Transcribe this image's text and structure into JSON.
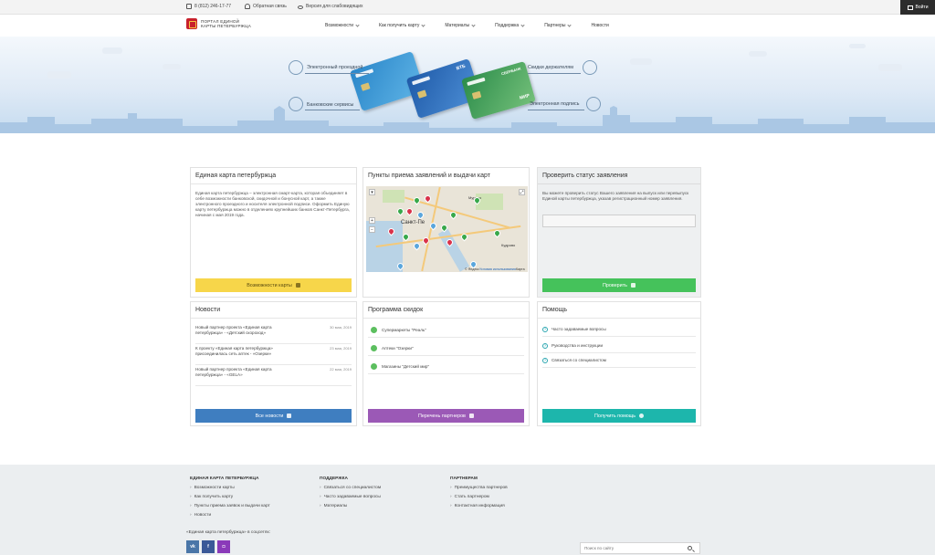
{
  "topbar": {
    "phone": "8 (812) 246-17-77",
    "feedback": "Обратная связь",
    "accessible": "Версия для слабовидящих",
    "login": "Войти"
  },
  "header": {
    "logo_line1": "ПОРТАЛ ЕДИНОЙ",
    "logo_line2": "КАРТЫ ПЕТЕРБУРЖЦА",
    "nav": [
      {
        "label": "Возможности",
        "has_menu": true
      },
      {
        "label": "Как получить карту",
        "has_menu": true
      },
      {
        "label": "Материалы",
        "has_menu": true
      },
      {
        "label": "Поддержка",
        "has_menu": true
      },
      {
        "label": "Партнеры",
        "has_menu": true
      },
      {
        "label": "Новости",
        "has_menu": false
      }
    ]
  },
  "banner": {
    "label_transport": "Электронный проездной",
    "label_discounts": "Скидки держателям",
    "label_bank": "Банковские сервисы",
    "label_signature": "Электронная подпись",
    "card2_brand": "ВТБ",
    "card3_brand": "СБЕРБАНК",
    "card3_mir": "МИР"
  },
  "card_panel": {
    "title": "Единая карта петербуржца",
    "text": "Единая карта петербуржца – электронная смарт-карта, которая объединяет в себе возможности банковской, скидочной и бонусной карт, а также электронного проездного и носителя электронной подписи. Оформить Единую карту петербуржца можно в отделениях крупнейших банков Санкт-Петербурга, начиная с мая 2019 года.",
    "button": "Возможности карты"
  },
  "map_panel": {
    "title": "Пункты приема заявлений и выдачи карт",
    "city_label": "Санкт-Пе",
    "district_label": "Кудрово",
    "district2_label": "Мурино",
    "footer_left": "© Яндекс",
    "footer_terms": "Условия использования",
    "footer_right": "Карта"
  },
  "status_panel": {
    "title": "Проверить статус заявления",
    "text": "Вы можете проверить статус Вашего заявления на выпуск или перевыпуск Единой карты петербуржца, указав регистрационный номер заявления.",
    "input_value": "",
    "button": "Проверить"
  },
  "news_panel": {
    "title": "Новости",
    "items": [
      {
        "text": "Новый партнер проекта «Единая карта петербуржца» - «Детский скороход»",
        "date": "30 мая, 2019"
      },
      {
        "text": "К проекту «Единая карта петербуржца» присоединилась сеть аптек - «Озерки»",
        "date": "23 мая, 2019"
      },
      {
        "text": "Новый партнер проекта «Единая карта петербуржца» - «GELA»",
        "date": "22 мая, 2019"
      }
    ],
    "button": "Все новости"
  },
  "discount_panel": {
    "title": "Программа скидок",
    "items": [
      "Супермаркеты \"Реаль\"",
      "Аптеки \"Озерки\"",
      "Магазины \"Детский мир\""
    ],
    "button": "Перечень партнеров"
  },
  "help_panel": {
    "title": "Помощь",
    "items": [
      "Часто задаваемые вопросы",
      "Руководства и инструкции",
      "Связаться со специалистом"
    ],
    "button": "Получить помощь"
  },
  "footer": {
    "col1_title": "ЕДИНАЯ КАРТА ПЕТЕРБУРЖЦА",
    "col1_links": [
      "Возможности карты",
      "Как получить карту",
      "Пункты приема заявок и выдачи карт",
      "Новости"
    ],
    "col2_title": "ПОДДЕРЖКА",
    "col2_links": [
      "Связаться со специалистом",
      "Часто задаваемые вопросы",
      "Материалы"
    ],
    "col3_title": "ПАРТНЕРАМ",
    "col3_links": [
      "Преимущества партнеров",
      "Стать партнером",
      "Контактная информация"
    ],
    "social_caption": "«Единая карта петербуржца» в соцсетях:",
    "social": [
      {
        "name": "vk-icon",
        "glyph": "vk",
        "color": "#4a76a8"
      },
      {
        "name": "facebook-icon",
        "glyph": "f",
        "color": "#3b5998"
      },
      {
        "name": "instagram-icon",
        "glyph": "◘",
        "color": "#8a3ab9"
      }
    ],
    "search_placeholder": "Поиск по сайту"
  }
}
